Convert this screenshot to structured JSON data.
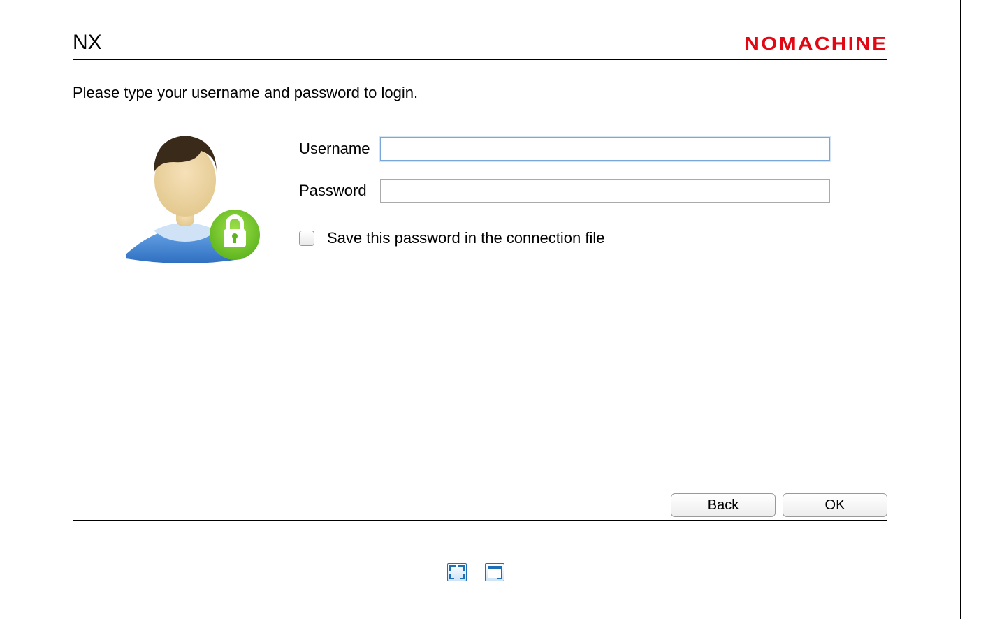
{
  "header": {
    "title": "NX",
    "brand": "NOMACHINE"
  },
  "instruction": "Please type your username and password to login.",
  "form": {
    "username_label": "Username",
    "username_value": "",
    "password_label": "Password",
    "password_value": "",
    "save_label": "Save this password in the connection file",
    "save_checked": false
  },
  "buttons": {
    "back": "Back",
    "ok": "OK"
  },
  "icons": {
    "avatar": "user-lock-icon",
    "fullscreen": "fullscreen-icon",
    "window": "window-resize-icon"
  }
}
